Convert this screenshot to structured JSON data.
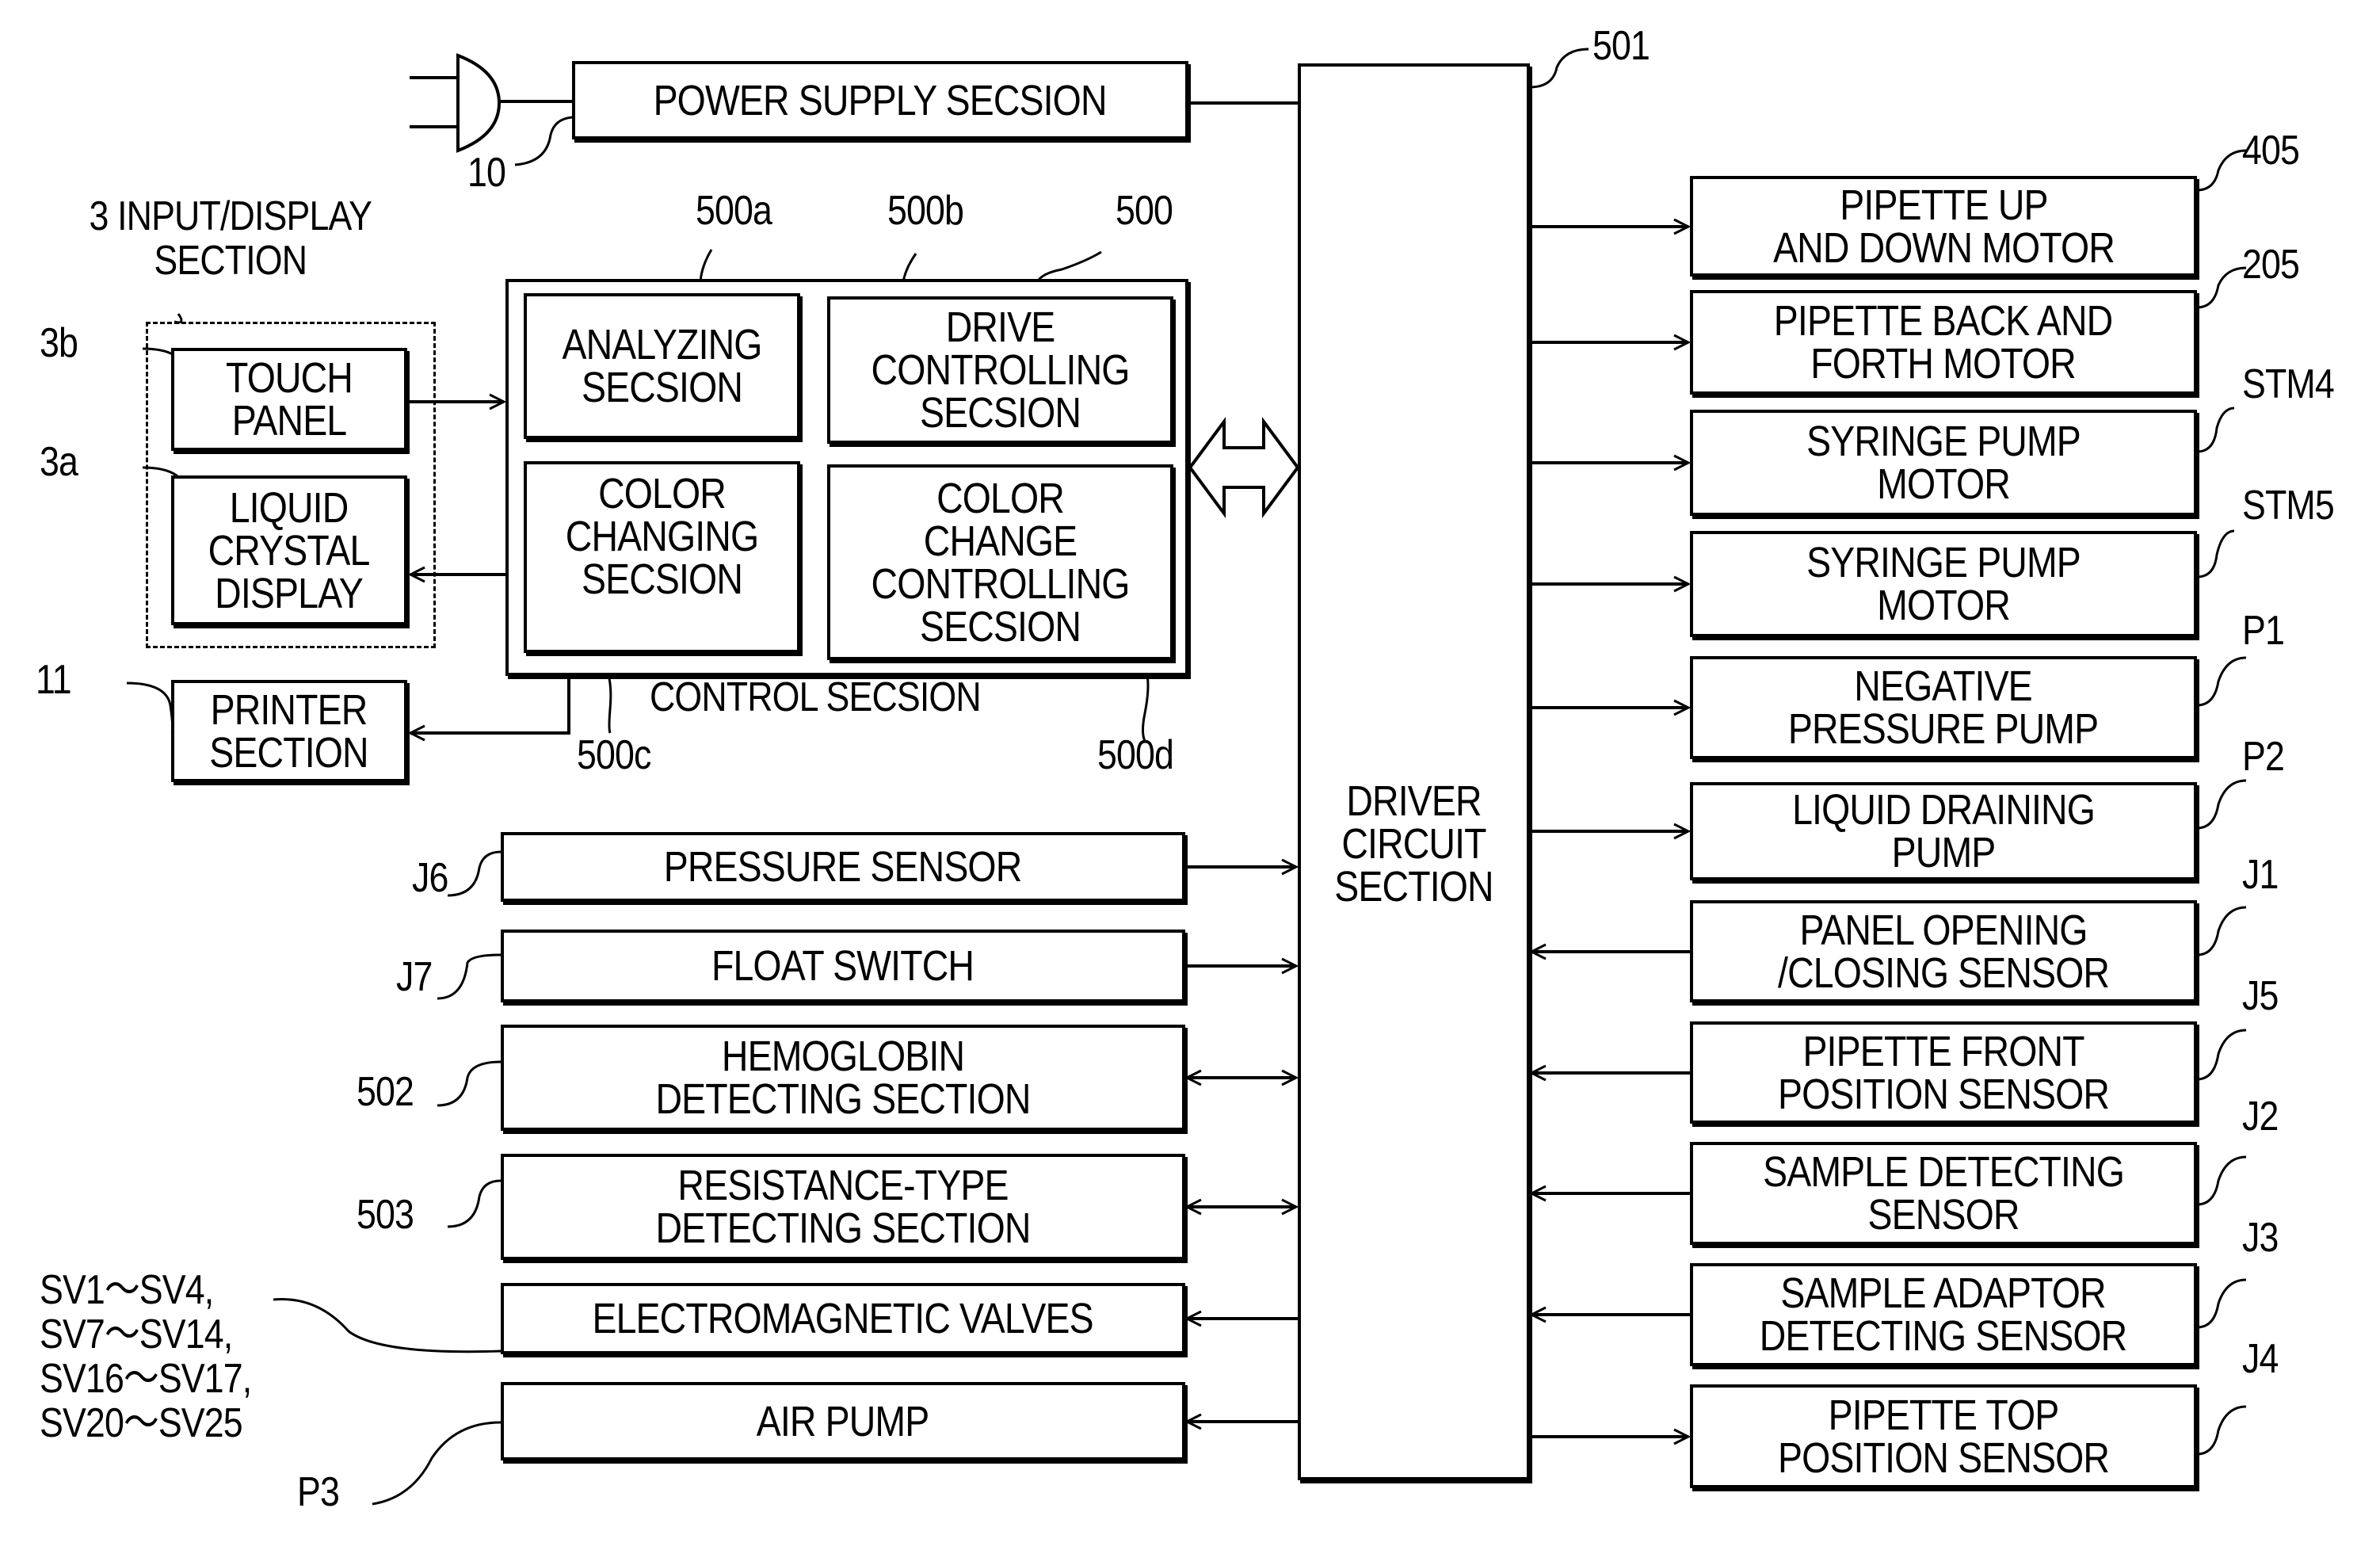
{
  "figure": {
    "power_supply": {
      "label": "POWER SUPPLY SECSION",
      "ref": "10"
    },
    "input_display": {
      "title": "3 INPUT/DISPLAY\nSECTION",
      "touch_panel": {
        "label": "TOUCH\nPANEL",
        "ref": "3b"
      },
      "lcd": {
        "label": "LIQUID\nCRYSTAL\nDISPLAY",
        "ref": "3a"
      }
    },
    "printer": {
      "label": "PRINTER\nSECTION",
      "ref": "11"
    },
    "control": {
      "label": "CONTROL SECSION",
      "ref": "500",
      "analyzing": {
        "label": "ANALYZING\nSECSION",
        "ref": "500a"
      },
      "drive_controlling": {
        "label": "DRIVE\nCONTROLLING\nSECSION",
        "ref": "500b"
      },
      "color_changing": {
        "label": "COLOR\nCHANGING\nSECSION",
        "ref": "500c"
      },
      "color_change_controlling": {
        "label": "COLOR\nCHANGE\nCONTROLLING\nSECSION",
        "ref": "500d"
      }
    },
    "driver": {
      "label": "DRIVER\nCIRCUIT\nSECTION",
      "ref": "501"
    },
    "left_devices": [
      {
        "label": "PRESSURE SENSOR",
        "ref": "J6",
        "direction": "to-driver"
      },
      {
        "label": "FLOAT SWITCH",
        "ref": "J7",
        "direction": "to-driver"
      },
      {
        "label": "HEMOGLOBIN\nDETECTING SECTION",
        "ref": "502",
        "direction": "bidirectional"
      },
      {
        "label": "RESISTANCE-TYPE\nDETECTING SECTION",
        "ref": "503",
        "direction": "bidirectional"
      },
      {
        "label": "ELECTROMAGNETIC VALVES",
        "ref": "SV1～SV4,\nSV7～SV14,\nSV16～SV17,\nSV20～SV25",
        "direction": "from-driver"
      },
      {
        "label": "AIR PUMP",
        "ref": "P3",
        "direction": "from-driver"
      }
    ],
    "right_devices": [
      {
        "label": "PIPETTE UP\nAND DOWN MOTOR",
        "ref": "405",
        "direction": "from-driver"
      },
      {
        "label": "PIPETTE BACK AND\nFORTH MOTOR",
        "ref": "205",
        "direction": "from-driver"
      },
      {
        "label": "SYRINGE PUMP\nMOTOR",
        "ref": "STM4",
        "direction": "from-driver"
      },
      {
        "label": "SYRINGE PUMP\nMOTOR",
        "ref": "STM5",
        "direction": "from-driver"
      },
      {
        "label": "NEGATIVE\nPRESSURE PUMP",
        "ref": "P1",
        "direction": "from-driver"
      },
      {
        "label": "LIQUID DRAINING\nPUMP",
        "ref": "P2",
        "direction": "from-driver"
      },
      {
        "label": "PANEL OPENING\n/CLOSING SENSOR",
        "ref": "J1",
        "direction": "to-driver"
      },
      {
        "label": "PIPETTE FRONT\nPOSITION SENSOR",
        "ref": "J5",
        "direction": "to-driver"
      },
      {
        "label": "SAMPLE DETECTING\nSENSOR",
        "ref": "J2",
        "direction": "to-driver"
      },
      {
        "label": "SAMPLE ADAPTOR\nDETECTING SENSOR",
        "ref": "J3",
        "direction": "to-driver"
      },
      {
        "label": "PIPETTE TOP\nPOSITION SENSOR",
        "ref": "J4",
        "direction": "from-driver"
      }
    ]
  }
}
